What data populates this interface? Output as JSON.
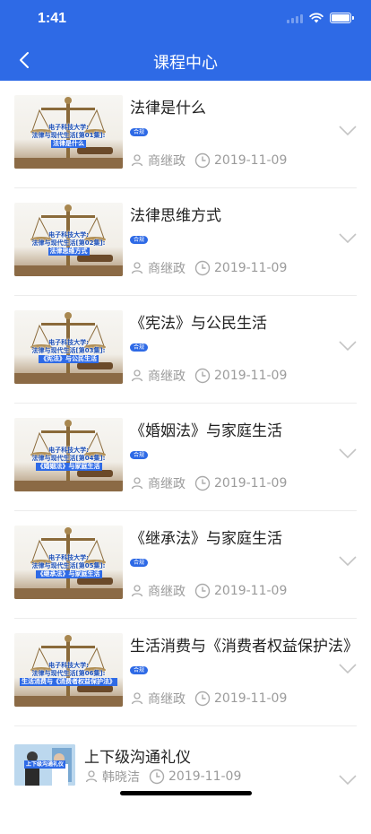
{
  "status_bar": {
    "time": "1:41"
  },
  "nav": {
    "title": "课程中心"
  },
  "courses": [
    {
      "title": "法律是什么",
      "tag": "合规",
      "author": "商继政",
      "date": "2019-11-09",
      "thumb_line1": "电子科技大学:",
      "thumb_line2": "法律与现代生活[第01集]:",
      "thumb_line3": "法律是什么"
    },
    {
      "title": "法律思维方式",
      "tag": "合规",
      "author": "商继政",
      "date": "2019-11-09",
      "thumb_line1": "电子科技大学:",
      "thumb_line2": "法律与现代生活[第02集]:",
      "thumb_line3": "法律思维方式"
    },
    {
      "title": "《宪法》与公民生活",
      "tag": "合规",
      "author": "商继政",
      "date": "2019-11-09",
      "thumb_line1": "电子科技大学:",
      "thumb_line2": "法律与现代生活[第03集]:",
      "thumb_line3": "《宪法》与公民生活"
    },
    {
      "title": "《婚姻法》与家庭生活",
      "tag": "合规",
      "author": "商继政",
      "date": "2019-11-09",
      "thumb_line1": "电子科技大学:",
      "thumb_line2": "法律与现代生活[第04集]:",
      "thumb_line3": "《婚姻法》与家庭生活"
    },
    {
      "title": "《继承法》与家庭生活",
      "tag": "合规",
      "author": "商继政",
      "date": "2019-11-09",
      "thumb_line1": "电子科技大学:",
      "thumb_line2": "法律与现代生活[第05集]:",
      "thumb_line3": "《继承法》与家庭生活"
    },
    {
      "title": "生活消费与《消费者权益保护法》",
      "tag": "合规",
      "author": "商继政",
      "date": "2019-11-09",
      "thumb_line1": "电子科技大学:",
      "thumb_line2": "法律与现代生活[第06集]:",
      "thumb_line3": "生活消费与《消费者权益保护法》"
    },
    {
      "title": "上下级沟通礼仪",
      "author": "韩晓洁",
      "date": "2019-11-09",
      "thumb_line3": "上下级沟通礼仪"
    }
  ],
  "icons": {
    "back": "chevron-left-icon",
    "author": "person-icon",
    "date": "clock-icon",
    "expand": "chevron-down-icon"
  },
  "colors": {
    "brand": "#2e6ae6",
    "meta_text": "#9b9b9b",
    "title_text": "#222222"
  }
}
